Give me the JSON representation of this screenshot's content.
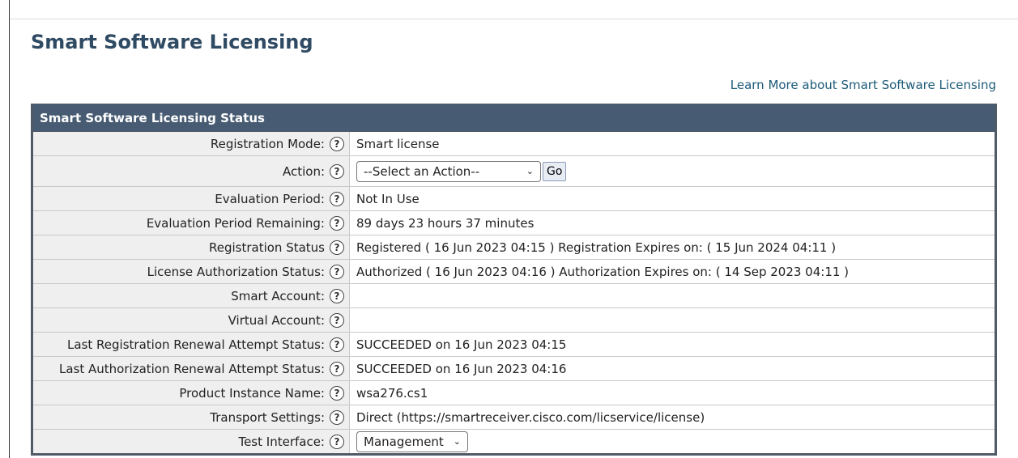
{
  "page": {
    "title": "Smart Software Licensing",
    "learn_more": "Learn More about Smart Software Licensing"
  },
  "status": {
    "header": "Smart Software Licensing Status",
    "rows": [
      {
        "label": "Registration Mode:",
        "value": "Smart license"
      },
      {
        "label": "Action:",
        "select": "--Select an Action--",
        "button": "Go"
      },
      {
        "label": "Evaluation Period:",
        "value": "Not In Use"
      },
      {
        "label": "Evaluation Period Remaining:",
        "value": "89 days 23 hours 37 minutes"
      },
      {
        "label": "Registration Status",
        "value": "Registered ( 16 Jun 2023 04:15 ) Registration Expires on: ( 15 Jun 2024 04:11 )"
      },
      {
        "label": "License Authorization Status:",
        "value": "Authorized ( 16 Jun 2023 04:16 ) Authorization Expires on: ( 14 Sep 2023 04:11 )"
      },
      {
        "label": "Smart Account:",
        "value": ""
      },
      {
        "label": "Virtual Account:",
        "value": ""
      },
      {
        "label": "Last Registration Renewal Attempt Status:",
        "value": "SUCCEEDED on 16 Jun 2023 04:15"
      },
      {
        "label": "Last Authorization Renewal Attempt Status:",
        "value": "SUCCEEDED on 16 Jun 2023 04:16"
      },
      {
        "label": "Product Instance Name:",
        "value": "wsa276.cs1"
      },
      {
        "label": "Transport Settings:",
        "value": "Direct (https://smartreceiver.cisco.com/licservice/license)"
      },
      {
        "label": "Test Interface:",
        "select": "Management"
      }
    ],
    "help_glyph": "?"
  }
}
